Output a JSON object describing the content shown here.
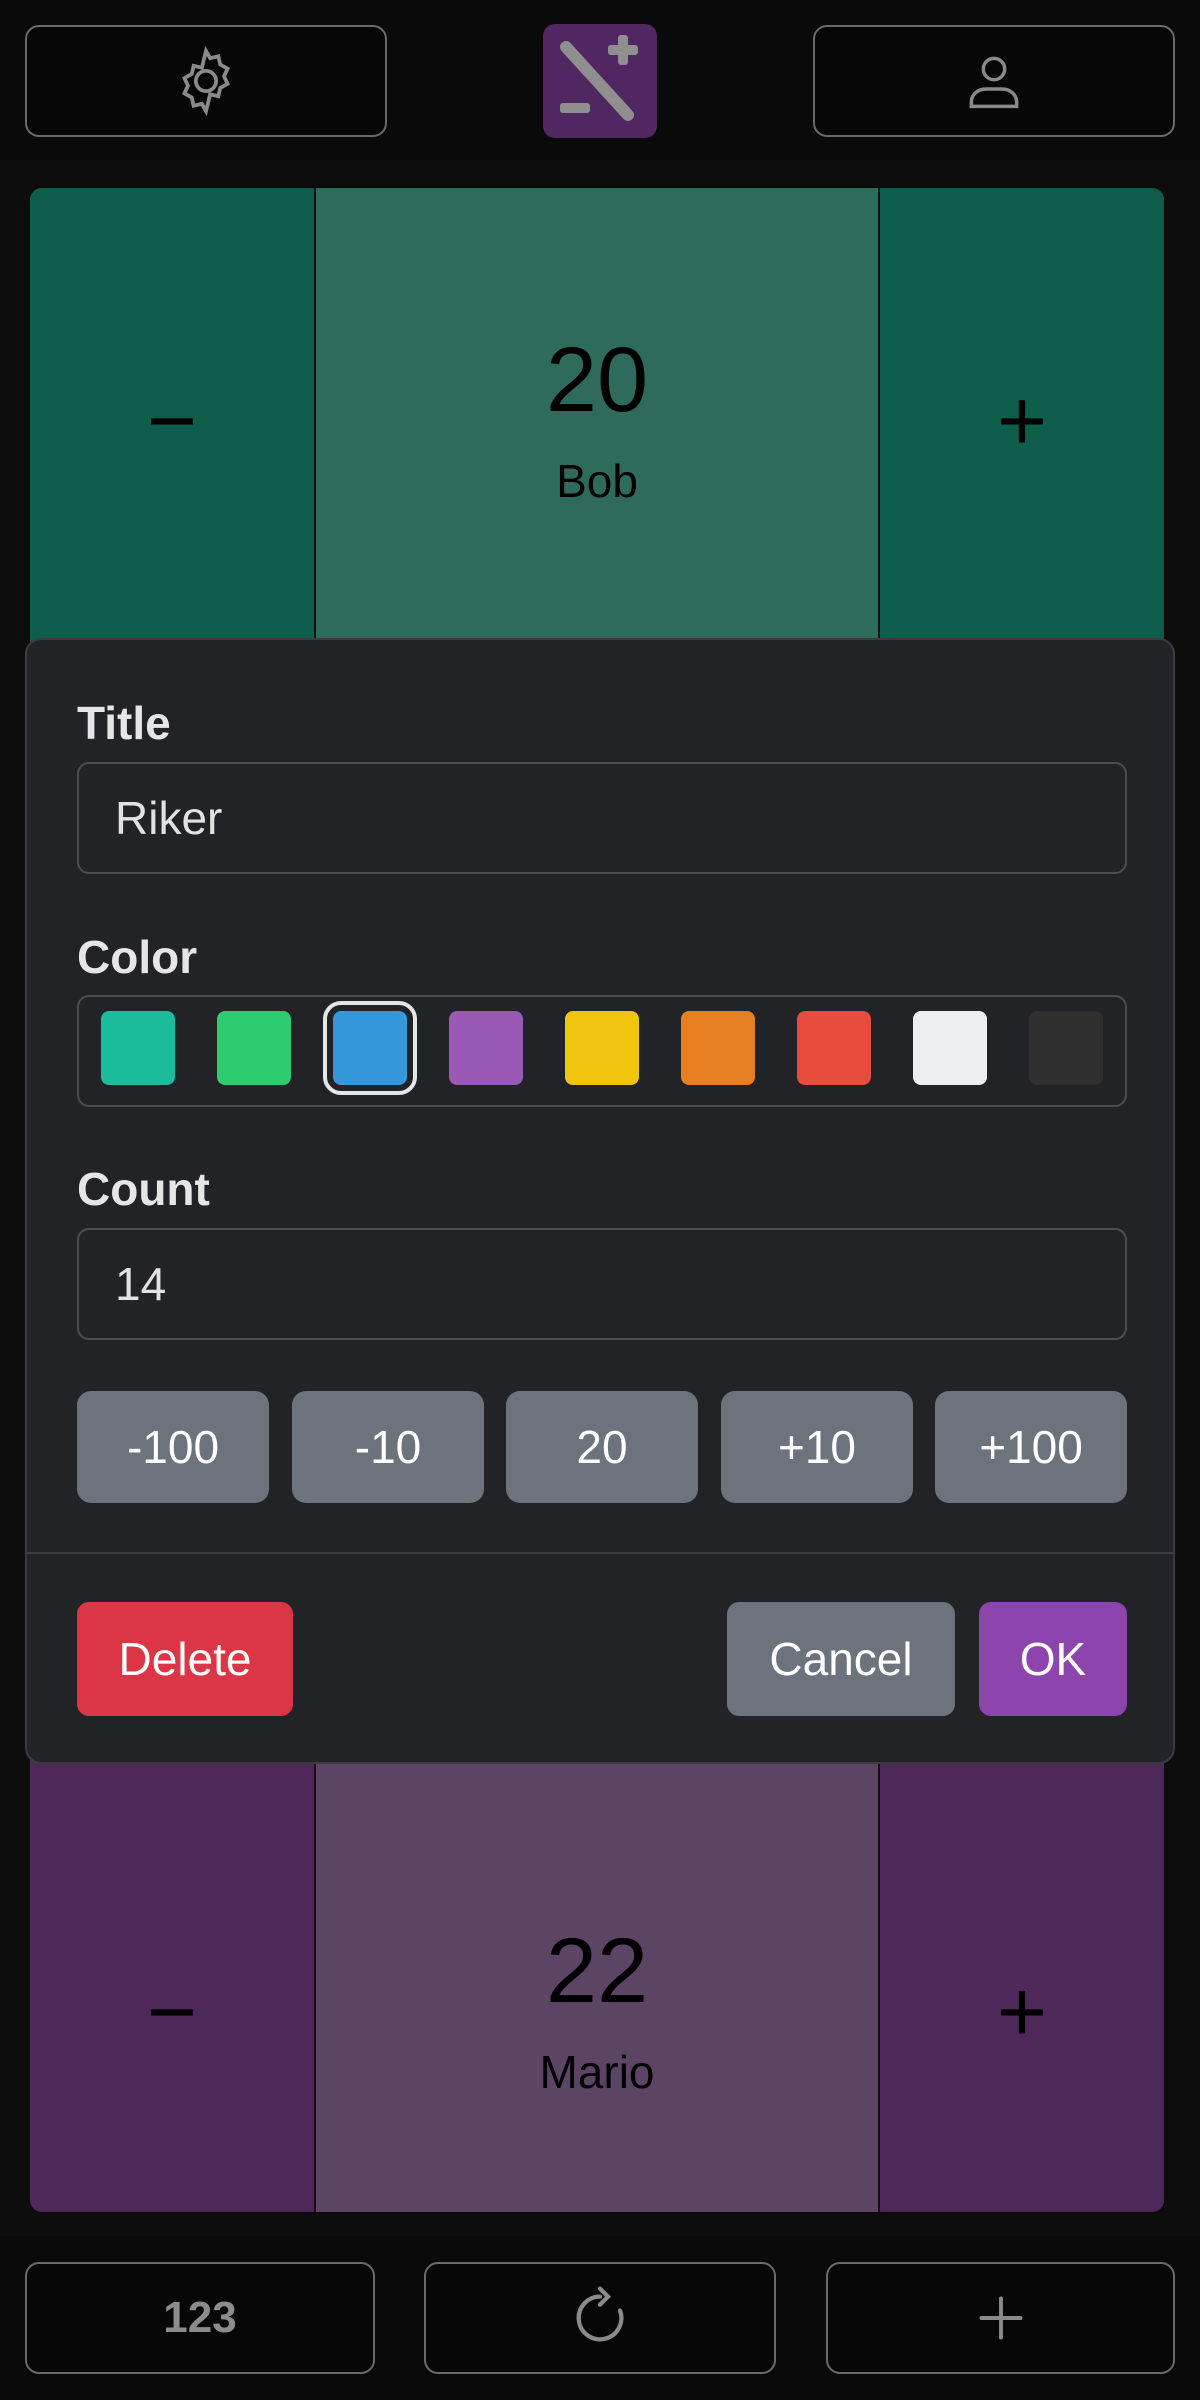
{
  "header": {
    "settings_icon": "gear-icon",
    "logo_icon": "plus-minus-logo-icon",
    "profile_icon": "user-icon"
  },
  "counters": [
    {
      "count": "20",
      "name": "Bob",
      "minus": "−",
      "plus": "+",
      "color": "#0e5e4b",
      "mid_color": "#2f6b5c"
    },
    {
      "count": "22",
      "name": "Mario",
      "minus": "−",
      "plus": "+",
      "color": "#4d2858",
      "mid_color": "#5c4464"
    }
  ],
  "modal": {
    "title_label": "Title",
    "title_value": "Riker",
    "color_label": "Color",
    "colors": [
      "#1abc9c",
      "#2ecc71",
      "#3498db",
      "#9b59b6",
      "#f1c40f",
      "#e67e22",
      "#e74c3c",
      "#ecf0f1",
      "#2f2f2f"
    ],
    "selected_color": "#3498db",
    "count_label": "Count",
    "count_value": "14",
    "steps": [
      "-100",
      "-10",
      "20",
      "+10",
      "+100"
    ],
    "delete_label": "Delete",
    "cancel_label": "Cancel",
    "ok_label": "OK",
    "delete_color": "#dc3545",
    "cancel_color": "#6c737c",
    "ok_color": "#8e44ad"
  },
  "footer": {
    "count_label": "123",
    "reset_icon": "refresh-icon",
    "add_icon": "plus-icon"
  }
}
